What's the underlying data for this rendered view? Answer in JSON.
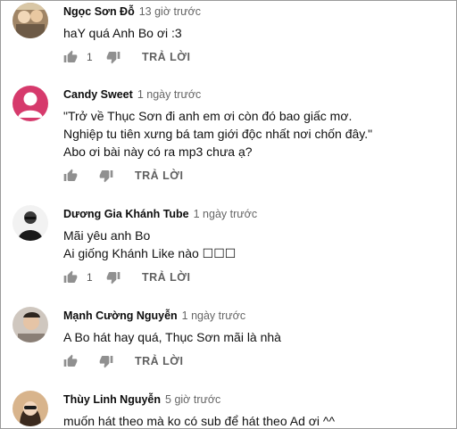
{
  "labels": {
    "reply": "TRẢ LỜI"
  },
  "comments": [
    {
      "author": "Ngọc Sơn Đỗ",
      "time": "13 giờ trước",
      "lines": [
        "haY quá Anh Bo ơi :3"
      ],
      "likes": "1",
      "avatar_color": "#b49a7c"
    },
    {
      "author": "Candy Sweet",
      "time": "1 ngày trước",
      "lines": [
        "\"Trở về Thục Sơn đi anh em ơi còn đó bao giấc mơ.",
        "Nghiệp tu tiên xưng bá tam giới độc nhất nơi chốn đây.\"",
        "Abo ơi bài này có ra mp3 chưa ạ?"
      ],
      "likes": "",
      "avatar_color": "#d63a6c"
    },
    {
      "author": "Dương Gia Khánh Tube",
      "time": "1 ngày trước",
      "lines": [
        "Mãi yêu anh Bo",
        "Ai giống Khánh Like nào ☐☐☐"
      ],
      "likes": "1",
      "avatar_color": "#2b2b2b"
    },
    {
      "author": "Mạnh Cường Nguyễn",
      "time": "1 ngày trước",
      "lines": [
        "A Bo hát hay quá, Thục Sơn mãi là nhà"
      ],
      "likes": "",
      "avatar_color": "#b8b0a8"
    },
    {
      "author": "Thùy Linh Nguyễn",
      "time": "5 giờ trước",
      "lines": [
        "muốn hát theo mà ko có sub để hát theo Ad ơi ^^"
      ],
      "likes": "",
      "avatar_color": "#caa27a"
    }
  ]
}
